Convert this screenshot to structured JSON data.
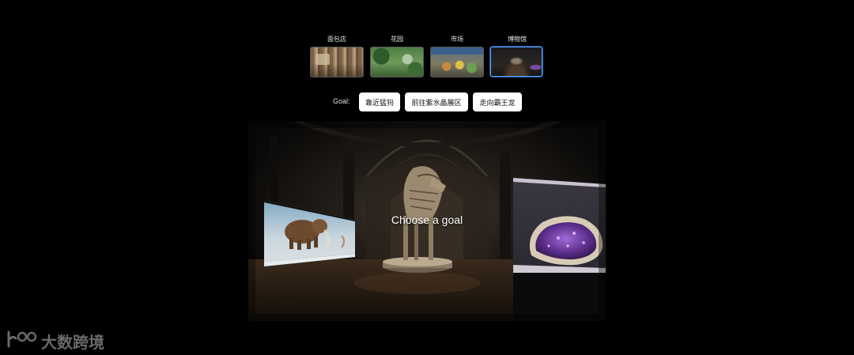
{
  "scenes": [
    {
      "label": "面包店",
      "icon": "bakery-thumbnail",
      "active": false
    },
    {
      "label": "花园",
      "icon": "garden-thumbnail",
      "active": false
    },
    {
      "label": "市场",
      "icon": "market-thumbnail",
      "active": false
    },
    {
      "label": "博物馆",
      "icon": "museum-thumbnail",
      "active": true
    }
  ],
  "goal": {
    "label": "Goal:",
    "options": [
      "靠近猛犸",
      "前往紫水晶展区",
      "走向霸王龙"
    ]
  },
  "viewport": {
    "overlay_text": "Choose a goal"
  },
  "watermark": {
    "text": "大数跨境"
  },
  "colors": {
    "background": "#000000",
    "active_border": "#5aa0ff",
    "button_bg": "#ffffff",
    "button_text": "#111111"
  }
}
